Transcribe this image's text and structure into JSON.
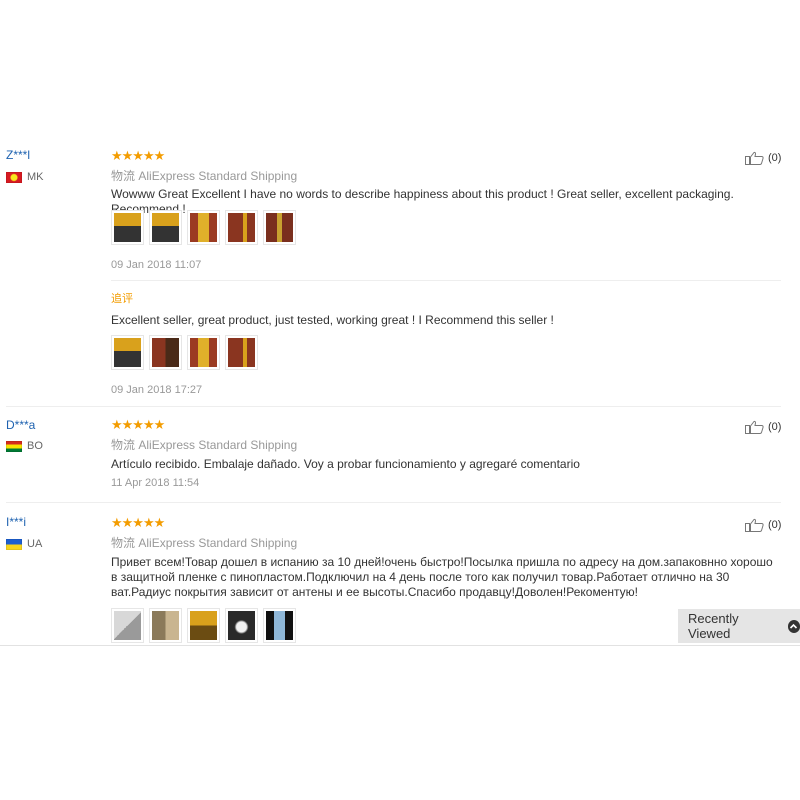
{
  "rating_stars": "★★★★★",
  "reviews": [
    {
      "user": "Z***l",
      "country": "MK",
      "shipping_prefix": "物流",
      "shipping": "AliExpress Standard Shipping",
      "text": "Wowww Great Excellent I have no words to describe happiness about this product ! Great seller, excellent packaging. Recommend !",
      "date": "09 Jan 2018 11:07",
      "likes": "(0)",
      "followup": {
        "label": "追评",
        "text": "Excellent seller, great product, just tested, working great ! I Recommend this seller !",
        "date": "09 Jan 2018 17:27"
      }
    },
    {
      "user": "D***a",
      "country": "BO",
      "shipping_prefix": "物流",
      "shipping": "AliExpress Standard Shipping",
      "text": "Artículo recibido. Embalaje dañado. Voy a probar funcionamiento y agregaré comentario",
      "date": "11 Apr 2018 11:54",
      "likes": "(0)"
    },
    {
      "user": "I***i",
      "country": "UA",
      "shipping_prefix": "物流",
      "shipping": "AliExpress Standard Shipping",
      "text": "Привет всем!Товар дошел в испанию за 10 дней!очень быстро!Посылка пришла по адресу на дом.запаковнно хорошо в защитной пленке с пинопластом.Подключил на 4 день после того как получил товар.Работает отлично на 30 ват.Радиус покрытия зависит от антены и ее высоты.Спасибо продавцу!Доволен!Рекоментую!",
      "likes": "(0)"
    }
  ],
  "recently_viewed": "Recently Viewed",
  "colors": {
    "link": "#1e62b0",
    "star": "#f39c00",
    "muted": "#999999"
  }
}
